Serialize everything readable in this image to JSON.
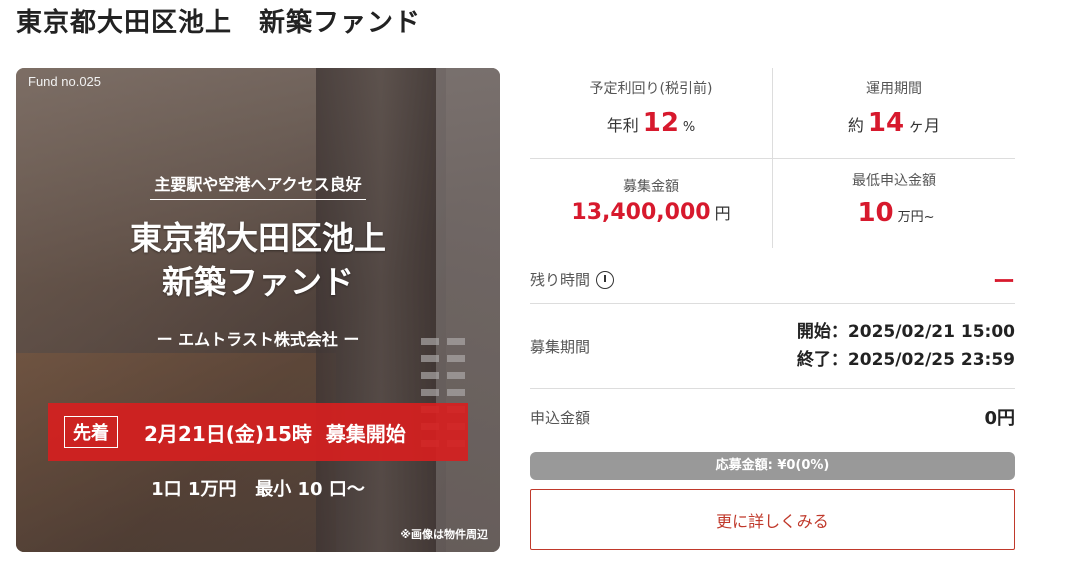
{
  "page": {
    "title": "東京都大田区池上　新築ファンド"
  },
  "banner": {
    "fund_no": "Fund no.025",
    "catch_copy": "主要駅や空港へアクセス良好",
    "title_line1": "東京都大田区池上",
    "title_line2": "新築ファンド",
    "company": "ー エムトラスト株式会社 ー",
    "badge": "先着",
    "start_text": "2月21日(金)15時  募集開始",
    "units_text": "1口 1万円   最小 10 口〜",
    "note": "※画像は物件周辺"
  },
  "stats": {
    "yield_label": "予定利回り(税引前)",
    "yield_prefix": "年利",
    "yield_value": "12",
    "yield_unit": "%",
    "period_label": "運用期間",
    "period_prefix": "約",
    "period_value": "14",
    "period_unit": "ヶ月",
    "raise_label": "募集金額",
    "raise_value": "13,400,000",
    "raise_unit": "円",
    "min_label": "最低申込金額",
    "min_value": "10",
    "min_unit": "万円~"
  },
  "remaining": {
    "label": "残り時間",
    "value": "ー"
  },
  "recruit": {
    "label": "募集期間",
    "start": "開始：2025/02/21 15:00",
    "end": "終了：2025/02/25 23:59"
  },
  "apply": {
    "label": "申込金額",
    "value": "0円"
  },
  "progress": {
    "text": "応募金額: ¥0(0%)",
    "percent": 0
  },
  "more_button": {
    "label": "更に詳しくみる"
  },
  "colors": {
    "accent": "#d7192d",
    "band": "#d62020",
    "progress_bg": "#999999"
  }
}
